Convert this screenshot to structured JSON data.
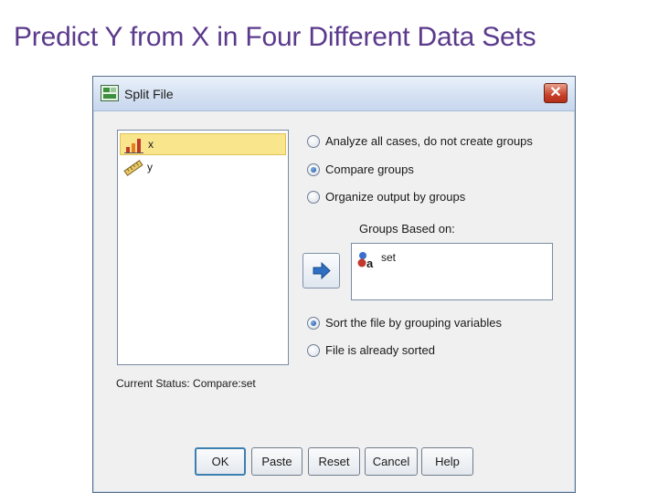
{
  "slide": {
    "title": "Predict Y from X in Four Different Data Sets"
  },
  "dialog": {
    "title": "Split File",
    "close_glyph": "✕",
    "variables": [
      {
        "name": "x",
        "icon": "scale-measure-icon",
        "selected": true
      },
      {
        "name": "y",
        "icon": "ruler-icon",
        "selected": false
      }
    ],
    "options": {
      "analyze_all": {
        "label": "Analyze all cases, do not create groups",
        "checked": false
      },
      "compare_groups": {
        "label": "Compare groups",
        "checked": true
      },
      "organize_output": {
        "label": "Organize output by groups",
        "checked": false
      }
    },
    "groups_based_on": {
      "label": "Groups Based on:",
      "items": [
        {
          "name": "set",
          "icon": "nominal-variable-icon"
        }
      ]
    },
    "sort_options": {
      "sort_file": {
        "label": "Sort the file by grouping variables",
        "checked": true
      },
      "already_sorted": {
        "label": "File is already sorted",
        "checked": false
      }
    },
    "status": "Current Status: Compare:set",
    "buttons": {
      "ok": "OK",
      "paste": "Paste",
      "reset": "Reset",
      "cancel": "Cancel",
      "help": "Help"
    },
    "colors": {
      "title": "#5b3a8c",
      "selection": "#f8e58c",
      "accent": "#2f6fc3"
    }
  }
}
